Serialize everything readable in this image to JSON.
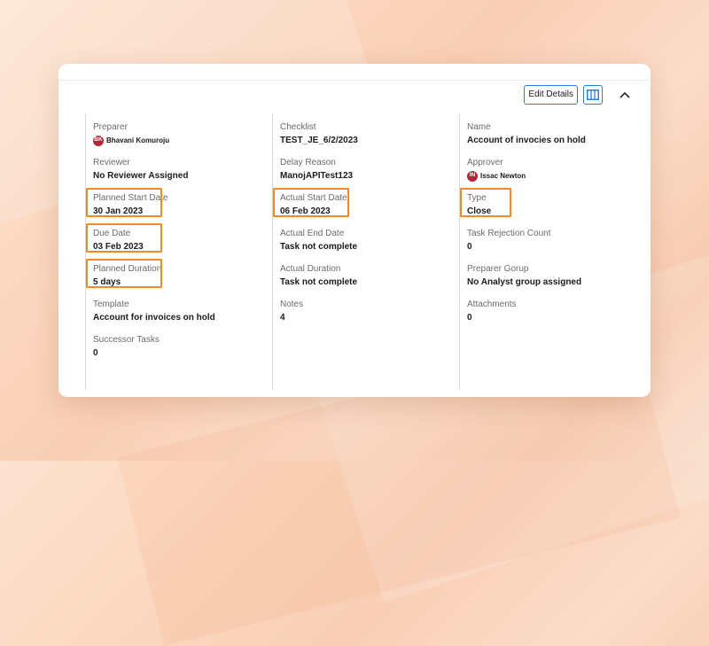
{
  "header": {
    "edit_details_label": "Edit Details",
    "columns_icon": "columns-icon",
    "collapse_icon": "chevron-up-icon"
  },
  "colors": {
    "accent": "#2e7fd8",
    "highlight": "#f08a24",
    "avatar": "#b3263a"
  },
  "columns": [
    {
      "fields": [
        {
          "label": "Preparer",
          "value": "Bhavani Komuroju",
          "avatar": "BK"
        },
        {
          "label": "Reviewer",
          "value": "No Reviewer Assigned"
        },
        {
          "label": "Planned Start Date",
          "value": "30 Jan 2023"
        },
        {
          "label": "Due Date",
          "value": "03 Feb 2023"
        },
        {
          "label": "Planned Duration",
          "value": "5 days"
        },
        {
          "label": "Template",
          "value": "Account for invoices on hold"
        },
        {
          "label": "Successor Tasks",
          "value": "0"
        }
      ]
    },
    {
      "fields": [
        {
          "label": "Checklist",
          "value": "TEST_JE_6/2/2023"
        },
        {
          "label": "Delay Reason",
          "value": "ManojAPITest123"
        },
        {
          "label": "Actual Start Date",
          "value": "06 Feb 2023"
        },
        {
          "label": "Actual End Date",
          "value": "Task not complete"
        },
        {
          "label": "Actual Duration",
          "value": "Task not complete"
        },
        {
          "label": "Notes",
          "value": "4"
        }
      ]
    },
    {
      "fields": [
        {
          "label": "Name",
          "value": "Account of invocies on hold"
        },
        {
          "label": "Approver",
          "value": "Issac Newton",
          "avatar": "IN"
        },
        {
          "label": "Type",
          "value": "Close"
        },
        {
          "label": "Task Rejection Count",
          "value": "0"
        },
        {
          "label": "Preparer Gorup",
          "value": "No Analyst group assigned"
        },
        {
          "label": "Attachments",
          "value": "0"
        }
      ]
    }
  ]
}
